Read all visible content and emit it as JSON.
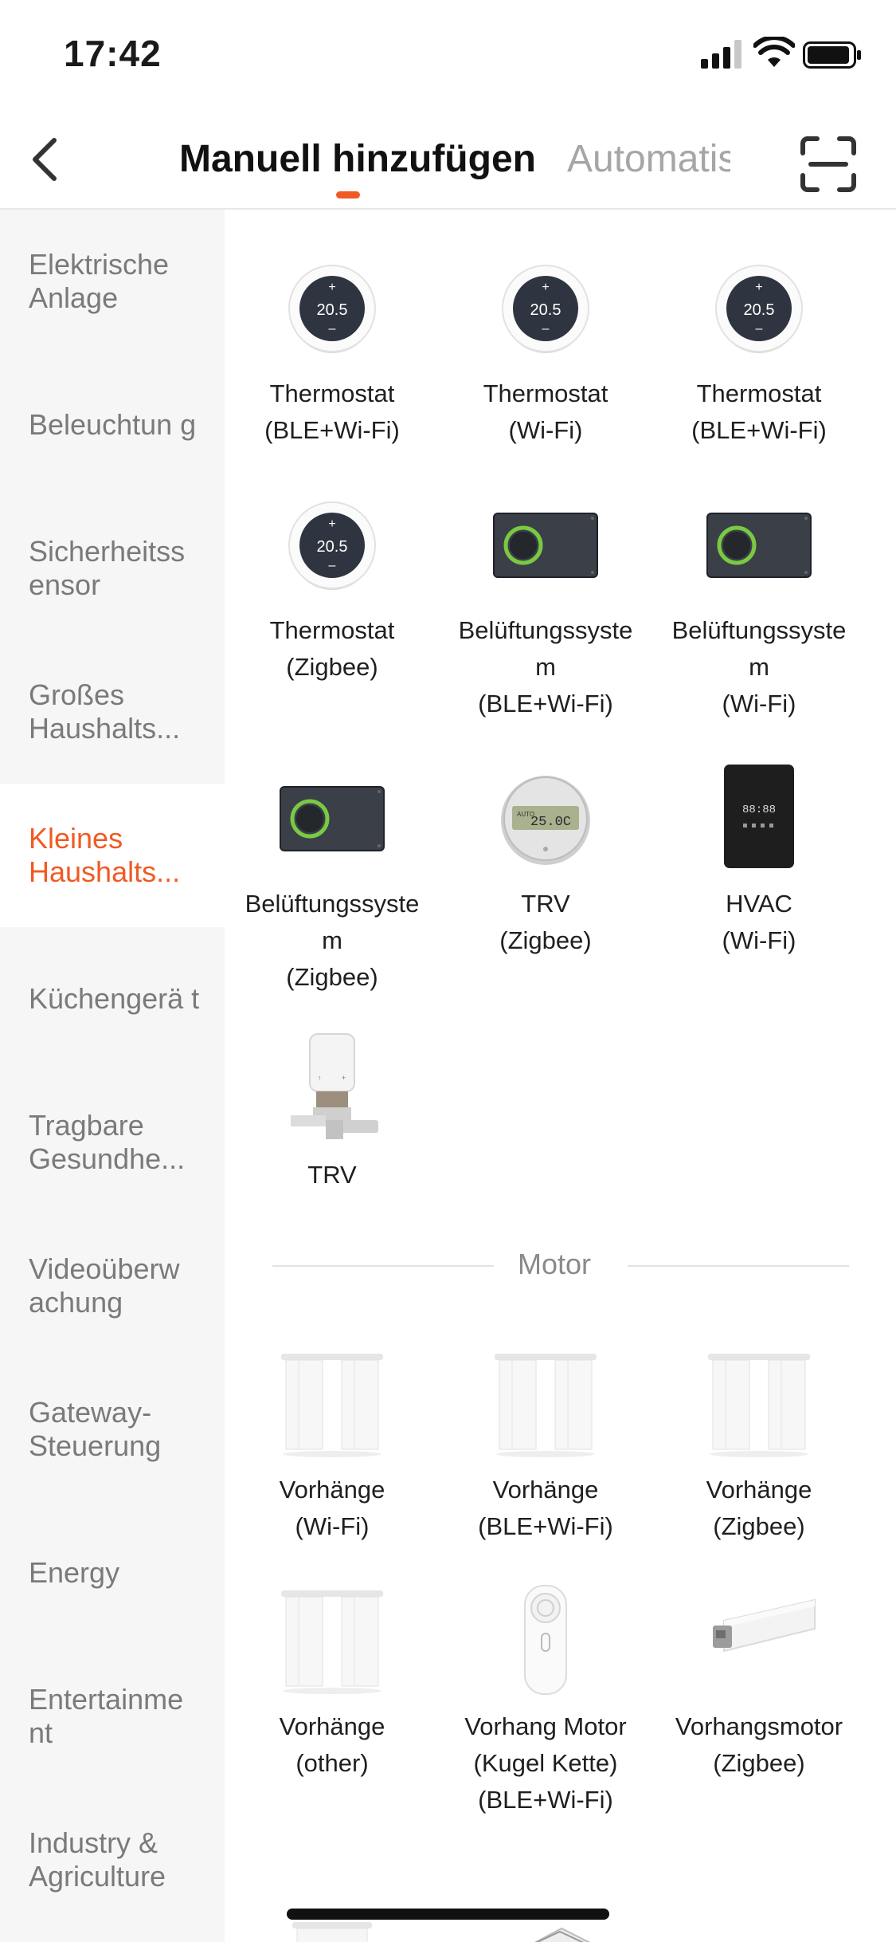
{
  "status": {
    "time": "17:42"
  },
  "header": {
    "tab_manual": "Manuell hinzufügen",
    "tab_auto": "Automatis",
    "accent": "#f05a22"
  },
  "sidebar": {
    "items": [
      {
        "label": "Elektrische Anlage"
      },
      {
        "label": "Beleuchtun g"
      },
      {
        "label": "Sicherheitss ensor"
      },
      {
        "label": "Großes Haushalts..."
      },
      {
        "label": "Kleines Haushalts...",
        "active": true
      },
      {
        "label": "Küchengerä t"
      },
      {
        "label": "Tragbare Gesundhe..."
      },
      {
        "label": "Videoüberw achung"
      },
      {
        "label": "Gateway- Steuerung"
      },
      {
        "label": "Energy"
      },
      {
        "label": "Entertainme nt"
      },
      {
        "label": "Industry & Agriculture"
      }
    ]
  },
  "devices": [
    {
      "label": "Thermostat\n(BLE+Wi-Fi)",
      "icon": "thermostat-icon",
      "display": "20.5"
    },
    {
      "label": "Thermostat\n(Wi-Fi)",
      "icon": "thermostat-icon",
      "display": "20.5"
    },
    {
      "label": "Thermostat\n(BLE+Wi-Fi)",
      "icon": "thermostat-icon",
      "display": "20.5"
    },
    {
      "label": "Thermostat\n(Zigbee)",
      "icon": "thermostat-icon",
      "display": "20.5"
    },
    {
      "label": "Belüftungssyste\nm\n(BLE+Wi-Fi)",
      "icon": "ventilation-icon"
    },
    {
      "label": "Belüftungssyste\nm\n(Wi-Fi)",
      "icon": "ventilation-icon"
    },
    {
      "label": "Belüftungssyste\nm\n(Zigbee)",
      "icon": "ventilation-icon"
    },
    {
      "label": "TRV\n(Zigbee)",
      "icon": "trv-dial-icon",
      "display": "25.0C",
      "display_mode": "AUTO"
    },
    {
      "label": "HVAC\n(Wi-Fi)",
      "icon": "hvac-icon",
      "display": "88:88"
    },
    {
      "label": "TRV",
      "icon": "trv-valve-icon"
    }
  ],
  "motor_section": {
    "title": "Motor"
  },
  "motor_devices": [
    {
      "label": "Vorhänge\n(Wi-Fi)",
      "icon": "curtain-icon"
    },
    {
      "label": "Vorhänge\n(BLE+Wi-Fi)",
      "icon": "curtain-icon"
    },
    {
      "label": "Vorhänge\n(Zigbee)",
      "icon": "curtain-icon"
    },
    {
      "label": "Vorhänge\n(other)",
      "icon": "curtain-icon"
    },
    {
      "label": "Vorhang Motor\n(Kugel Kette)\n(BLE+Wi-Fi)",
      "icon": "chain-motor-icon"
    },
    {
      "label": "Vorhangsmotor\n(Zigbee)",
      "icon": "rail-motor-icon"
    },
    {
      "label": "",
      "icon": "partial-device-icon"
    },
    {
      "label": "",
      "icon": "window-opener-icon"
    }
  ]
}
